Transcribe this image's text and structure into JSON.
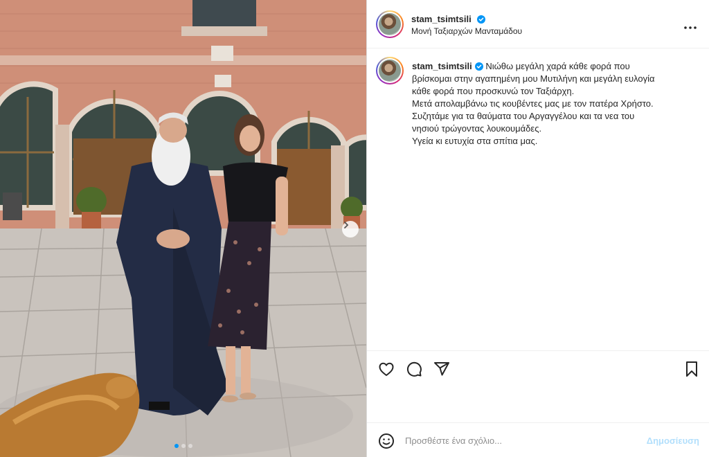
{
  "post": {
    "username": "stam_tsimtsili",
    "location": "Μονή Ταξιαρχών Μανταμάδου",
    "caption_lines": [
      "Νιώθω μεγάλη χαρά κάθε φορά που",
      "βρίσκομαι στην αγαπημένη μου Μυτιλήνη και μεγάλη ευλογία",
      "κάθε φορά που προσκυνώ τον Ταξιάρχη.",
      "Μετά απολαμβάνω τις κουβέντες μας με τον πατέρα Χρήστο.",
      "Συζητάμε για τα θαύματα του Αργαγγέλου και τα νεα του",
      "νησιού τρώγοντας λουκουμάδες.",
      "Υγεία κι ευτυχία στα σπίτια μας."
    ]
  },
  "photo": {
    "carousel_dots": 3,
    "active_dot": 0
  },
  "icons": {
    "like": "heart-icon",
    "comment": "comment-icon",
    "share": "share-icon",
    "save": "bookmark-icon",
    "more": "more-icon",
    "emoji": "emoji-icon",
    "verified": "verified-icon",
    "next": "chevron-right-icon"
  },
  "comment": {
    "placeholder": "Προσθέστε ένα σχόλιο...",
    "post_label": "Δημοσίευση"
  },
  "colors": {
    "accent": "#0095f6",
    "post_disabled": "#b2dffc",
    "text": "#262626"
  }
}
